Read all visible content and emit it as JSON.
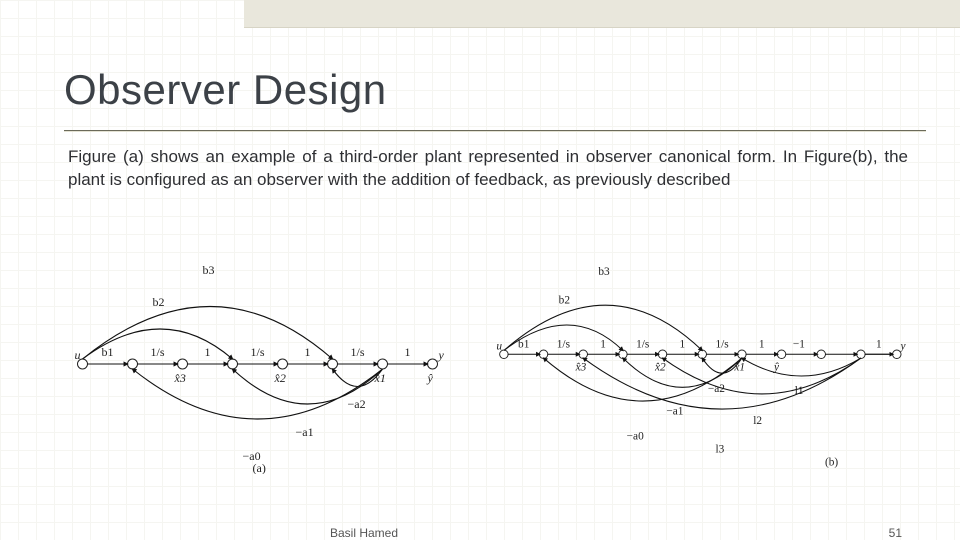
{
  "slide": {
    "title": "Observer Design",
    "body": "Figure (a) shows an example of a third-order plant represented in observer canonical form. In Figure(b), the plant is configured as an observer with the addition of feedback, as previously described"
  },
  "footer": {
    "author": "Basil Hamed",
    "page": "51"
  },
  "figA": {
    "caption": "(a)",
    "input": "u",
    "output": "y",
    "chain": [
      "b1",
      "1/s",
      "1",
      "1/s",
      "1",
      "1/s",
      "1"
    ],
    "states": [
      "x̂3",
      "x̂2",
      "x̂1",
      "ŷ"
    ],
    "forward_gains": [
      "b2",
      "b3"
    ],
    "feedback_gains": [
      "−a2",
      "−a1",
      "−a0"
    ]
  },
  "figB": {
    "caption": "(b)",
    "input": "u",
    "output": "y",
    "chain": [
      "b1",
      "1/s",
      "1",
      "1/s",
      "1",
      "1/s",
      "1",
      "−1",
      "1"
    ],
    "states": [
      "x̂3",
      "x̂2",
      "x̂1",
      "ŷ"
    ],
    "forward_gains": [
      "b2",
      "b3"
    ],
    "feedback_gains": [
      "−a2",
      "−a1",
      "−a0"
    ],
    "observer_gains": [
      "l1",
      "l2",
      "l3"
    ]
  }
}
